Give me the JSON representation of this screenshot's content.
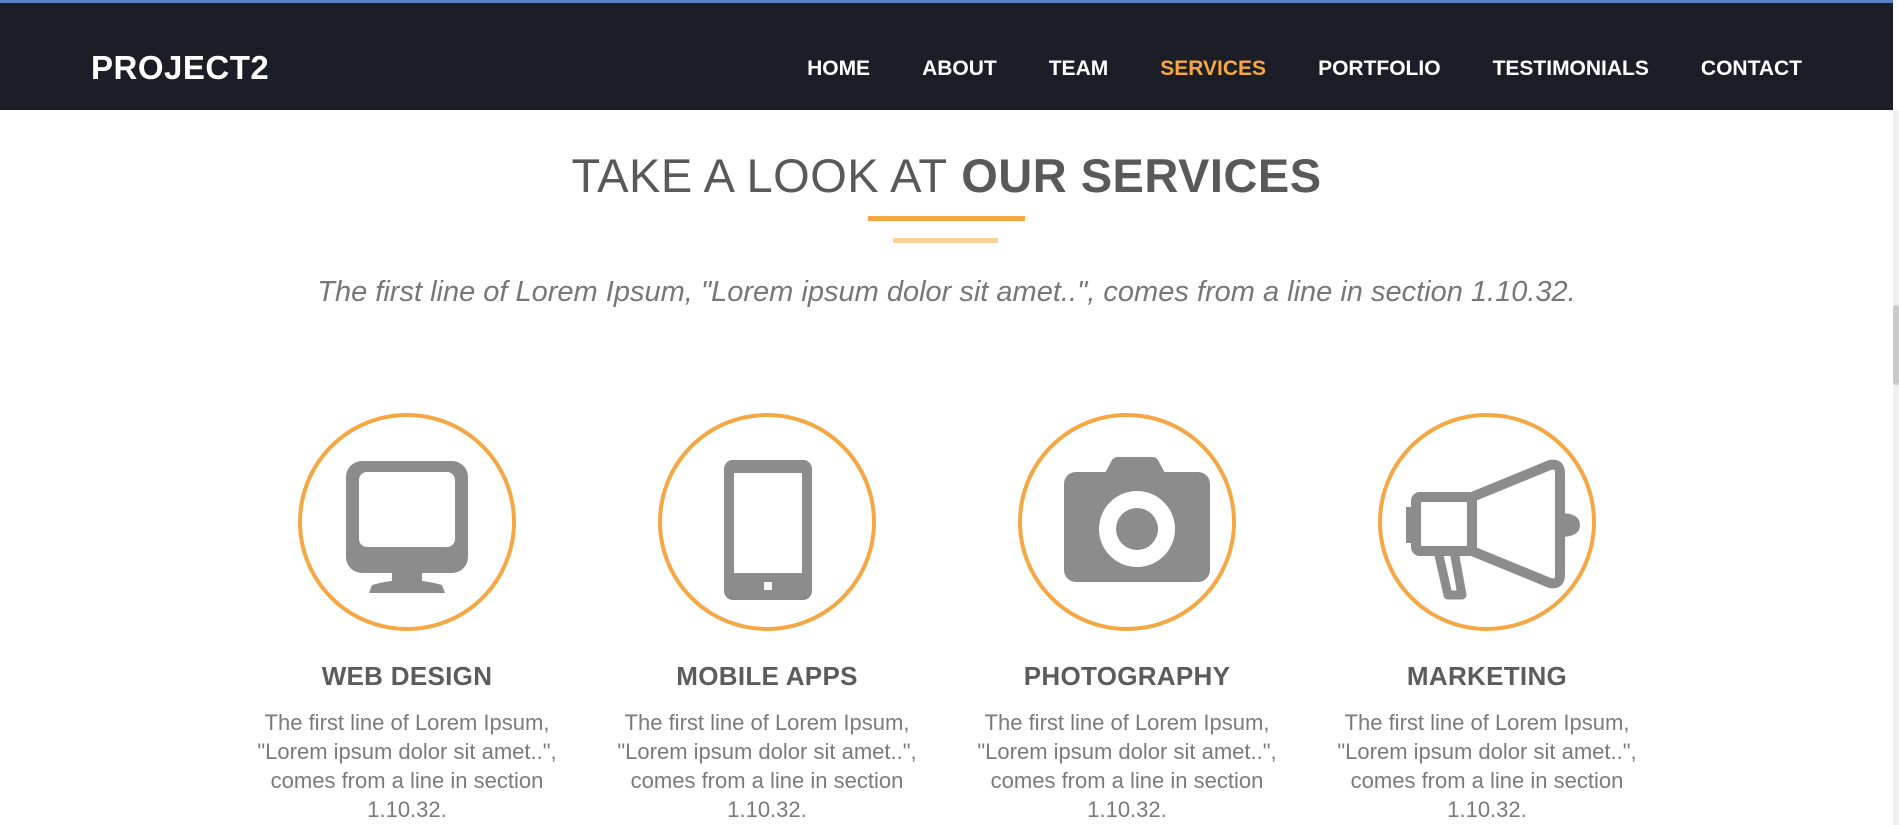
{
  "nav": {
    "brand": "PROJECT2",
    "items": [
      {
        "label": "HOME"
      },
      {
        "label": "ABOUT"
      },
      {
        "label": "TEAM"
      },
      {
        "label": "SERVICES",
        "active": true
      },
      {
        "label": "PORTFOLIO"
      },
      {
        "label": "TESTIMONIALS"
      },
      {
        "label": "CONTACT"
      }
    ]
  },
  "section": {
    "heading_light": "TAKE A LOOK AT",
    "heading_bold": "OUR SERVICES",
    "intro": "The first line of Lorem Ipsum, \"Lorem ipsum dolor sit amet..\", comes from a line in section 1.10.32."
  },
  "services": [
    {
      "title": "WEB DESIGN",
      "icon": "monitor-icon",
      "desc": "The first line of Lorem Ipsum, \"Lorem ipsum dolor sit amet..\", comes from a line in section 1.10.32."
    },
    {
      "title": "MOBILE APPS",
      "icon": "smartphone-icon",
      "desc": "The first line of Lorem Ipsum, \"Lorem ipsum dolor sit amet..\", comes from a line in section 1.10.32."
    },
    {
      "title": "PHOTOGRAPHY",
      "icon": "camera-icon",
      "desc": "The first line of Lorem Ipsum, \"Lorem ipsum dolor sit amet..\", comes from a line in section 1.10.32."
    },
    {
      "title": "MARKETING",
      "icon": "megaphone-icon",
      "desc": "The first line of Lorem Ipsum, \"Lorem ipsum dolor sit amet..\", comes from a line in section 1.10.32."
    }
  ],
  "colors": {
    "accent": "#f4a742",
    "accent_light": "#fbd19a",
    "navbar_bg": "#1b1e27",
    "icon_gray": "#8c8c8c",
    "heading_text": "#595959"
  }
}
